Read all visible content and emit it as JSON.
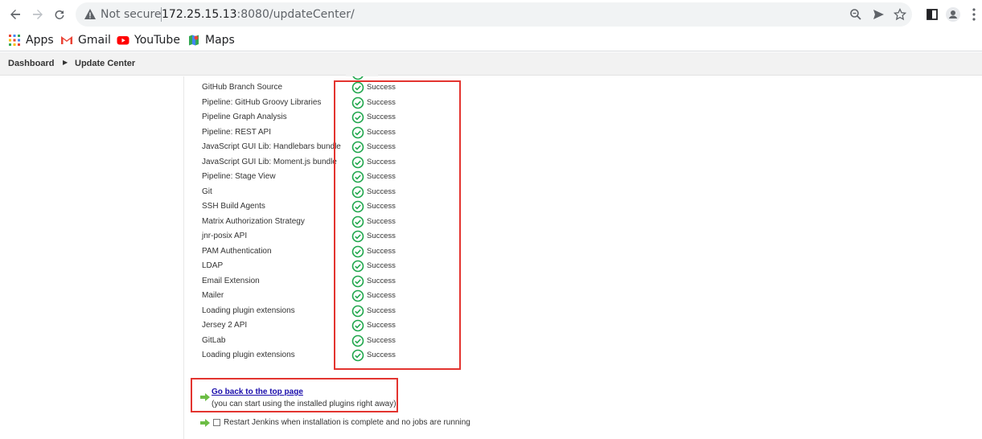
{
  "browser": {
    "security_label": "Not secure",
    "url_host": "172.25.15.13",
    "url_rest": ":8080/updateCenter/",
    "bookmarks": [
      {
        "label": "Apps",
        "icon": "apps-grid-icon"
      },
      {
        "label": "Gmail",
        "icon": "gmail-icon"
      },
      {
        "label": "YouTube",
        "icon": "youtube-icon"
      },
      {
        "label": "Maps",
        "icon": "maps-icon"
      }
    ]
  },
  "breadcrumb": {
    "items": [
      "Dashboard",
      "Update Center"
    ]
  },
  "plugins": [
    {
      "name": "GitHub Branch Source",
      "status": "Success"
    },
    {
      "name": "Pipeline: GitHub Groovy Libraries",
      "status": "Success"
    },
    {
      "name": "Pipeline Graph Analysis",
      "status": "Success"
    },
    {
      "name": "Pipeline: REST API",
      "status": "Success"
    },
    {
      "name": "JavaScript GUI Lib: Handlebars bundle",
      "status": "Success"
    },
    {
      "name": "JavaScript GUI Lib: Moment.js bundle",
      "status": "Success"
    },
    {
      "name": "Pipeline: Stage View",
      "status": "Success"
    },
    {
      "name": "Git",
      "status": "Success"
    },
    {
      "name": "SSH Build Agents",
      "status": "Success"
    },
    {
      "name": "Matrix Authorization Strategy",
      "status": "Success"
    },
    {
      "name": "jnr-posix API",
      "status": "Success"
    },
    {
      "name": "PAM Authentication",
      "status": "Success"
    },
    {
      "name": "LDAP",
      "status": "Success"
    },
    {
      "name": "Email Extension",
      "status": "Success"
    },
    {
      "name": "Mailer",
      "status": "Success"
    },
    {
      "name": "Loading plugin extensions",
      "status": "Success"
    },
    {
      "name": "Jersey 2 API",
      "status": "Success"
    },
    {
      "name": "GitLab",
      "status": "Success"
    },
    {
      "name": "Loading plugin extensions",
      "status": "Success"
    }
  ],
  "footer": {
    "back_link": "Go back to the top page",
    "back_note": "(you can start using the installed plugins right away)",
    "restart_label": "Restart Jenkins when installation is complete and no jobs are running"
  },
  "colors": {
    "success_green": "#1ea64b",
    "highlight_red": "#e3342f",
    "link_blue": "#1a0dab"
  }
}
